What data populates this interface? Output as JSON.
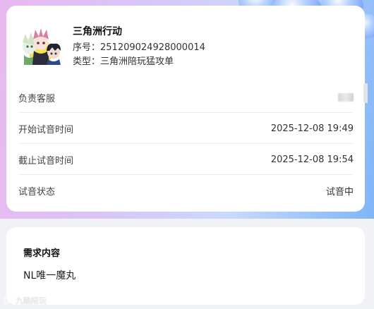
{
  "order": {
    "product_name": "三角洲行动",
    "serial_line": "序号：251209024928000014",
    "type_line": "类型：三角洲陪玩猛攻单"
  },
  "details": [
    {
      "label": "负责客服",
      "value": ""
    },
    {
      "label": "开始试音时间",
      "value": "2025-12-08 19:49"
    },
    {
      "label": "截止试音时间",
      "value": "2025-12-08 19:54"
    },
    {
      "label": "试音状态",
      "value": "试音中"
    }
  ],
  "requirement": {
    "title": "需求内容",
    "content": "NL唯一魔丸"
  },
  "watermark": {
    "text": "九酷陪玩"
  },
  "colors": {
    "status_accent": "#3b7ff0",
    "card_bg": "#ffffff"
  },
  "icons": {
    "product_avatar": "anime-characters-avatar",
    "watermark_logo": "brand-logo-icon"
  }
}
